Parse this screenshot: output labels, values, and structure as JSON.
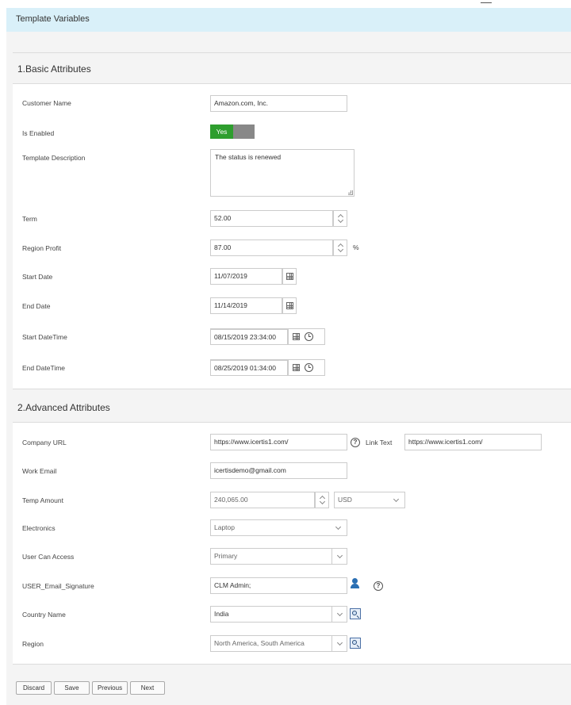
{
  "header": {
    "title": "Template Variables"
  },
  "sections": {
    "basic": {
      "title": "1.Basic Attributes"
    },
    "advanced": {
      "title": "2.Advanced Attributes"
    }
  },
  "basic": {
    "customer_name": {
      "label": "Customer Name",
      "value": "Amazon.com, Inc."
    },
    "is_enabled": {
      "label": "Is Enabled",
      "toggle_label": "Yes"
    },
    "template_description": {
      "label": "Template Description",
      "value": "The status is renewed"
    },
    "term": {
      "label": "Term",
      "value": "52.00"
    },
    "region_profit": {
      "label": "Region Profit",
      "value": "87.00",
      "unit": "%"
    },
    "start_date": {
      "label": "Start Date",
      "value": "11/07/2019"
    },
    "end_date": {
      "label": "End Date",
      "value": "11/14/2019"
    },
    "start_datetime": {
      "label": "Start DateTime",
      "value": "08/15/2019 23:34:00"
    },
    "end_datetime": {
      "label": "End DateTime",
      "value": "08/25/2019 01:34:00"
    }
  },
  "advanced": {
    "company_url": {
      "label": "Company URL",
      "value": "https://www.icertis1.com/"
    },
    "link_text": {
      "label": "Link Text",
      "value": "https://www.icertis1.com/"
    },
    "work_email": {
      "label": "Work Email",
      "value": "icertisdemo@gmail.com"
    },
    "temp_amount": {
      "label": "Temp Amount",
      "value": "240,065.00",
      "currency": "USD"
    },
    "electronics": {
      "label": "Electronics",
      "value": "Laptop"
    },
    "user_can_access": {
      "label": "User Can Access",
      "value": "Primary"
    },
    "user_email_signature": {
      "label": "USER_Email_Signature",
      "value": "CLM Admin;"
    },
    "country_name": {
      "label": "Country Name",
      "value": "India"
    },
    "region": {
      "label": "Region",
      "value": "North America, South America"
    }
  },
  "help_glyph": "?",
  "buttons": {
    "discard": "Discard",
    "save": "Save",
    "previous": "Previous",
    "next": "Next"
  },
  "icons": {
    "calendar": "calendar-icon",
    "clock": "clock-icon",
    "help": "help-icon",
    "user_picker": "add-user-icon",
    "lookup": "lookup-icon"
  },
  "colors": {
    "header_bg": "#d9f0f9",
    "toggle_on": "#2e9e2e",
    "toggle_off": "#888888",
    "user_icon": "#2a6fb3"
  }
}
